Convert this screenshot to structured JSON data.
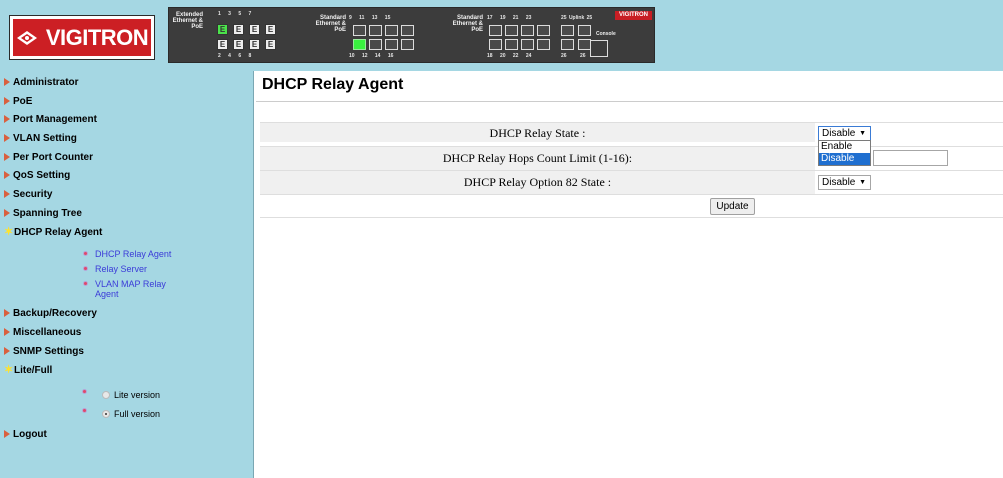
{
  "header": {
    "logo_text": "VIGITRON",
    "panel": {
      "group_extended": "Extended Ethernet & PoE",
      "group_standard_1": "Standard Ethernet & PoE",
      "group_standard_2": "Standard Ethernet & PoE",
      "ext_top_nums": "1 3 5 7",
      "ext_bottom_nums": "2 4 6 8",
      "std1_top_nums": "9 11 13 15",
      "std1_bottom_nums": "10 12 14 16",
      "std2_top_nums": "17 19 21 23",
      "std2_bottom_nums": "18 20 22 24",
      "uplink_top_nums": "25 Uplink 25",
      "uplink_bottom_nums": "26 26",
      "port_letter": "E",
      "mini_logo": "VIGITRON",
      "console_label": "Console"
    }
  },
  "sidebar": {
    "items": [
      {
        "label": "Administrator"
      },
      {
        "label": "PoE"
      },
      {
        "label": "Port Management"
      },
      {
        "label": "VLAN Setting"
      },
      {
        "label": "Per Port Counter"
      },
      {
        "label": "QoS Setting"
      },
      {
        "label": "Security"
      },
      {
        "label": "Spanning Tree"
      },
      {
        "label": "DHCP Relay Agent"
      },
      {
        "label": "Backup/Recovery"
      },
      {
        "label": "Miscellaneous"
      },
      {
        "label": "SNMP Settings"
      },
      {
        "label": "Lite/Full"
      },
      {
        "label": "Logout"
      }
    ],
    "dhcp_sub": [
      {
        "label": "DHCP Relay Agent"
      },
      {
        "label": "Relay Server"
      },
      {
        "label": "VLAN MAP Relay Agent"
      }
    ],
    "version": {
      "lite": "Lite version",
      "full": "Full version",
      "selected": "Full version"
    }
  },
  "main": {
    "title": "DHCP Relay Agent",
    "rows": [
      {
        "label": "DHCP Relay State :",
        "value": "Disable"
      },
      {
        "label": "DHCP Relay Hops Count Limit (1-16):",
        "value": ""
      },
      {
        "label": "DHCP Relay Option 82 State :",
        "value": "Disable"
      }
    ],
    "dropdown_options": [
      "Enable",
      "Disable"
    ],
    "dropdown_highlighted": "Disable",
    "update_label": "Update"
  }
}
